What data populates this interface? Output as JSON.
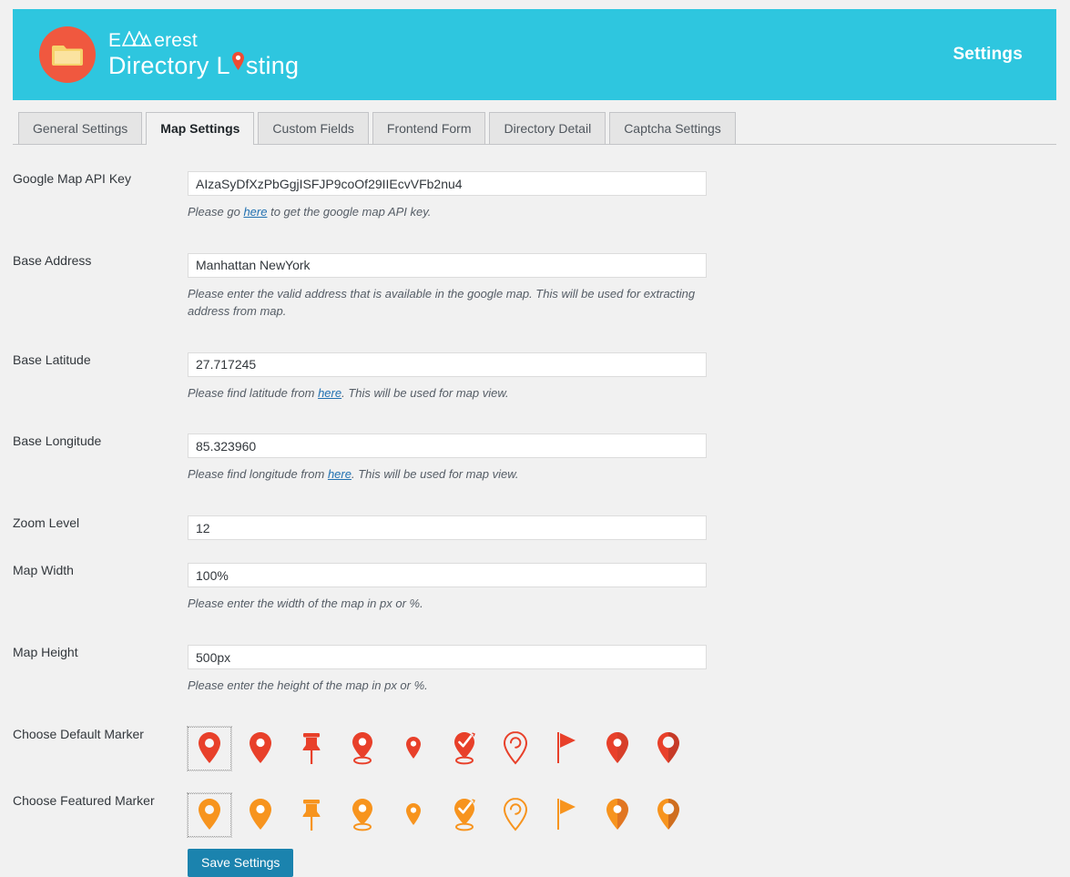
{
  "header": {
    "brand_line1_prefix": "E",
    "brand_line1_suffix": "erest",
    "brand_line2_prefix": "Directory L",
    "brand_line2_suffix": "sting",
    "logo_icon": "folder-icon",
    "mountain_icon": "mountain-icon",
    "pin_icon": "map-pin-icon",
    "settings_title": "Settings",
    "background_color": "#2ec6df",
    "badge_color": "#f0583f",
    "folder_color": "#fcd462"
  },
  "tabs": [
    {
      "label": "General Settings",
      "active": false
    },
    {
      "label": "Map Settings",
      "active": true
    },
    {
      "label": "Custom Fields",
      "active": false
    },
    {
      "label": "Frontend Form",
      "active": false
    },
    {
      "label": "Directory Detail",
      "active": false
    },
    {
      "label": "Captcha Settings",
      "active": false
    }
  ],
  "fields": {
    "api_key": {
      "label": "Google Map API Key",
      "value": "AIzaSyDfXzPbGgjISFJP9coOf29IIEcvVFb2nu4",
      "help_before": "Please go ",
      "help_link": "here",
      "help_after": " to get the google map API key."
    },
    "base_address": {
      "label": "Base Address",
      "value": "Manhattan NewYork",
      "help": "Please enter the valid address that is available in the google map. This will be used for extracting address from map."
    },
    "base_latitude": {
      "label": "Base Latitude",
      "value": "27.717245",
      "help_before": "Please find latitude from ",
      "help_link": "here",
      "help_after": ". This will be used for map view."
    },
    "base_longitude": {
      "label": "Base Longitude",
      "value": "85.323960",
      "help_before": "Please find longitude from ",
      "help_link": "here",
      "help_after": ". This will be used for map view."
    },
    "zoom_level": {
      "label": "Zoom Level",
      "value": "12",
      "help": ""
    },
    "map_width": {
      "label": "Map Width",
      "value": "100%",
      "help": "Please enter the width of the map in px or %."
    },
    "map_height": {
      "label": "Map Height",
      "value": "500px",
      "help": "Please enter the height of the map in px or %."
    },
    "default_marker": {
      "label": "Choose Default Marker",
      "color": "#e8402a",
      "selected_index": 0,
      "icons": [
        "pin-ring-icon",
        "pin-solid-icon",
        "pushpin-icon",
        "pin-base-icon",
        "pin-small-icon",
        "pin-check-icon",
        "pin-outline-icon",
        "flag-icon",
        "pin-dot-icon",
        "pin-hollow-icon"
      ]
    },
    "featured_marker": {
      "label": "Choose Featured Marker",
      "color": "#f7941e",
      "selected_index": 0,
      "icons": [
        "pin-ring-icon",
        "pin-solid-icon",
        "pushpin-icon",
        "pin-base-icon",
        "pin-small-icon",
        "pin-check-icon",
        "pin-outline-icon",
        "flag-icon",
        "pin-dot-icon",
        "pin-hollow-icon"
      ]
    }
  },
  "save_button": {
    "label": "Save Settings",
    "color": "#1b83ae"
  }
}
